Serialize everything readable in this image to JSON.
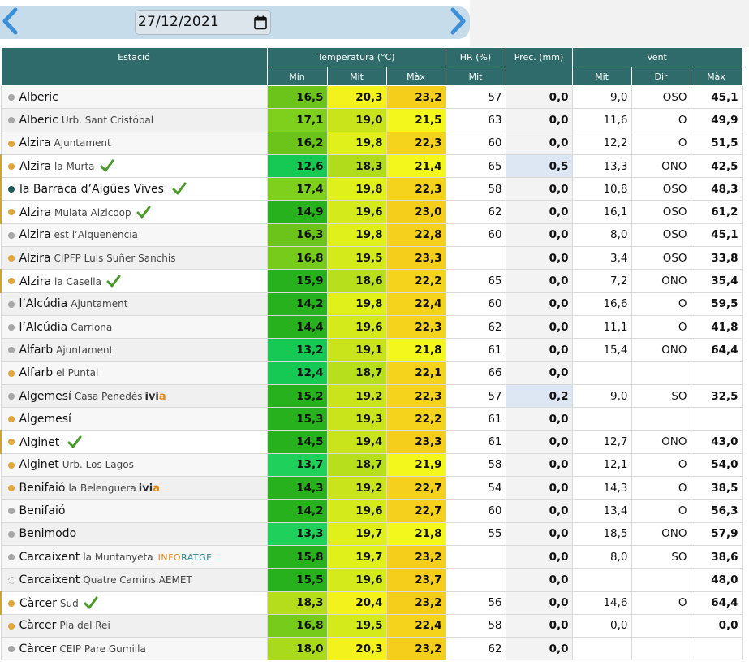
{
  "toolbar": {
    "date": "27/12/2021",
    "colors": {
      "bar": "#c7dcea",
      "arrow": "#3a8fd6"
    }
  },
  "table": {
    "headers": {
      "station": "Estació",
      "temperature": "Temperatura (°C)",
      "humidity": "HR (%)",
      "precip": "Prec. (mm)",
      "wind": "Vent",
      "min": "Mín",
      "mit": "Mit",
      "max": "Màx",
      "hr_mit": "Mit",
      "wind_mit": "Mit",
      "wind_dir": "Dir",
      "wind_max": "Màx"
    },
    "rows": [
      {
        "name": "Alberic",
        "sub": "",
        "dot": "#a7a7a7",
        "tick": false,
        "badge": "",
        "hl": false,
        "tmin": "16,5",
        "tmit": "20,3",
        "tmax": "23,2",
        "hr": "57",
        "prec": "0,0",
        "pblue": false,
        "wmit": "9,0",
        "wdir": "OSO",
        "wmax": "45,1",
        "cmin": "#6cc41a",
        "cmit": "#f3f21c",
        "cmax": "#f5ce1c"
      },
      {
        "name": "Alberic",
        "sub": "Urb. Sant Cristóbal",
        "dot": "#a7a7a7",
        "tick": false,
        "badge": "",
        "hl": false,
        "tmin": "17,1",
        "tmit": "19,0",
        "tmax": "21,5",
        "hr": "63",
        "prec": "0,0",
        "pblue": false,
        "wmit": "11,6",
        "wdir": "O",
        "wmax": "49,9",
        "cmin": "#7ed01c",
        "cmit": "#c9e41a",
        "cmax": "#f4f71c"
      },
      {
        "name": "Alzira",
        "sub": "Ajuntament",
        "dot": "#e2a53b",
        "tick": false,
        "badge": "",
        "hl": false,
        "tmin": "16,2",
        "tmit": "19,8",
        "tmax": "22,3",
        "hr": "60",
        "prec": "0,0",
        "pblue": false,
        "wmit": "12,2",
        "wdir": "O",
        "wmax": "51,5",
        "cmin": "#6cc41a",
        "cmit": "#dff01a",
        "cmax": "#f5d31c"
      },
      {
        "name": "Alzira",
        "sub": "la Murta",
        "dot": "#e2a53b",
        "tick": true,
        "badge": "",
        "hl": true,
        "tmin": "12,6",
        "tmit": "18,3",
        "tmax": "21,4",
        "hr": "65",
        "prec": "0,5",
        "pblue": true,
        "wmit": "13,3",
        "wdir": "ONO",
        "wmax": "42,5",
        "cmin": "#15c954",
        "cmit": "#b0dc1c",
        "cmax": "#f3f71c"
      },
      {
        "name": "la Barraca d’Aigües Vives",
        "sub": "",
        "dot": "#1f5a5a",
        "tick": true,
        "badge": "",
        "hl": true,
        "tmin": "17,4",
        "tmit": "19,8",
        "tmax": "22,3",
        "hr": "58",
        "prec": "0,0",
        "pblue": false,
        "wmit": "10,8",
        "wdir": "OSO",
        "wmax": "48,3",
        "cmin": "#7ed01c",
        "cmit": "#dff01a",
        "cmax": "#f5d31c"
      },
      {
        "name": "Alzira",
        "sub": "Mulata Alzicoop",
        "dot": "#e2a53b",
        "tick": true,
        "badge": "",
        "hl": true,
        "tmin": "14,9",
        "tmit": "19,6",
        "tmax": "23,0",
        "hr": "62",
        "prec": "0,0",
        "pblue": false,
        "wmit": "16,1",
        "wdir": "OSO",
        "wmax": "61,2",
        "cmin": "#27b11d",
        "cmit": "#d4ea1a",
        "cmax": "#f5ce1c"
      },
      {
        "name": "Alzira",
        "sub": "est l’Alquenència",
        "dot": "#a7a7a7",
        "tick": false,
        "badge": "",
        "hl": false,
        "tmin": "16,3",
        "tmit": "19,8",
        "tmax": "22,8",
        "hr": "60",
        "prec": "0,0",
        "pblue": false,
        "wmit": "8,0",
        "wdir": "OSO",
        "wmax": "45,1",
        "cmin": "#6cc41a",
        "cmit": "#dff01a",
        "cmax": "#f5d01c"
      },
      {
        "name": "Alzira",
        "sub": "CIPFP Luis Suñer Sanchis",
        "dot": "#e2a53b",
        "tick": false,
        "badge": "",
        "hl": false,
        "tmin": "16,8",
        "tmit": "19,5",
        "tmax": "23,3",
        "hr": "",
        "prec": "0,0",
        "pblue": false,
        "wmit": "3,4",
        "wdir": "OSO",
        "wmax": "33,8",
        "cmin": "#76cb1b",
        "cmit": "#d4ea1a",
        "cmax": "#f5ce1c"
      },
      {
        "name": "Alzira",
        "sub": "la Casella",
        "dot": "#e2a53b",
        "tick": true,
        "badge": "",
        "hl": true,
        "tmin": "15,9",
        "tmit": "18,6",
        "tmax": "22,2",
        "hr": "65",
        "prec": "0,0",
        "pblue": false,
        "wmit": "7,2",
        "wdir": "ONO",
        "wmax": "35,4",
        "cmin": "#27b11d",
        "cmit": "#b8df1c",
        "cmax": "#f5d31c"
      },
      {
        "name": "l’Alcúdia",
        "sub": "Ajuntament",
        "dot": "#a7a7a7",
        "tick": false,
        "badge": "",
        "hl": false,
        "tmin": "14,2",
        "tmit": "19,8",
        "tmax": "22,4",
        "hr": "60",
        "prec": "0,0",
        "pblue": false,
        "wmit": "16,6",
        "wdir": "O",
        "wmax": "59,5",
        "cmin": "#27b11d",
        "cmit": "#dff01a",
        "cmax": "#f5d31c"
      },
      {
        "name": "l’Alcúdia",
        "sub": "Carriona",
        "dot": "#a7a7a7",
        "tick": false,
        "badge": "",
        "hl": false,
        "tmin": "14,4",
        "tmit": "19,6",
        "tmax": "22,3",
        "hr": "62",
        "prec": "0,0",
        "pblue": false,
        "wmit": "11,1",
        "wdir": "O",
        "wmax": "41,8",
        "cmin": "#27b11d",
        "cmit": "#d4ea1a",
        "cmax": "#f5d31c"
      },
      {
        "name": "Alfarb",
        "sub": "Ajuntament",
        "dot": "#a7a7a7",
        "tick": false,
        "badge": "",
        "hl": false,
        "tmin": "13,2",
        "tmit": "19,1",
        "tmax": "21,8",
        "hr": "61",
        "prec": "0,0",
        "pblue": false,
        "wmit": "15,4",
        "wdir": "ONO",
        "wmax": "64,4",
        "cmin": "#15c954",
        "cmit": "#c9e41a",
        "cmax": "#f3f71c"
      },
      {
        "name": "Alfarb",
        "sub": "el Puntal",
        "dot": "#e2a53b",
        "tick": false,
        "badge": "",
        "hl": false,
        "tmin": "12,4",
        "tmit": "18,7",
        "tmax": "22,1",
        "hr": "66",
        "prec": "0,0",
        "pblue": false,
        "wmit": "",
        "wdir": "",
        "wmax": "",
        "cmin": "#15c954",
        "cmit": "#b8df1c",
        "cmax": "#f5d31c"
      },
      {
        "name": "Algemesí",
        "sub": "Casa Penedés",
        "dot": "#a7a7a7",
        "tick": false,
        "badge": "ivia",
        "hl": false,
        "tmin": "15,2",
        "tmit": "19,2",
        "tmax": "22,3",
        "hr": "57",
        "prec": "0,2",
        "pblue": true,
        "wmit": "9,0",
        "wdir": "SO",
        "wmax": "32,5",
        "cmin": "#27b11d",
        "cmit": "#c9e41a",
        "cmax": "#f5d31c"
      },
      {
        "name": "Algemesí",
        "sub": "",
        "dot": "#e2a53b",
        "tick": false,
        "badge": "",
        "hl": false,
        "tmin": "15,3",
        "tmit": "19,3",
        "tmax": "22,2",
        "hr": "61",
        "prec": "0,0",
        "pblue": false,
        "wmit": "",
        "wdir": "",
        "wmax": "",
        "cmin": "#27b11d",
        "cmit": "#c9e41a",
        "cmax": "#f5d31c"
      },
      {
        "name": "Alginet",
        "sub": "",
        "dot": "#e2a53b",
        "tick": true,
        "badge": "",
        "hl": true,
        "tmin": "14,5",
        "tmit": "19,4",
        "tmax": "23,3",
        "hr": "61",
        "prec": "0,0",
        "pblue": false,
        "wmit": "12,7",
        "wdir": "ONO",
        "wmax": "43,0",
        "cmin": "#27b11d",
        "cmit": "#c9e41a",
        "cmax": "#f5ce1c"
      },
      {
        "name": "Alginet",
        "sub": "Urb. Los Lagos",
        "dot": "#e2a53b",
        "tick": false,
        "badge": "",
        "hl": false,
        "tmin": "13,7",
        "tmit": "18,7",
        "tmax": "21,9",
        "hr": "58",
        "prec": "0,0",
        "pblue": false,
        "wmit": "12,1",
        "wdir": "O",
        "wmax": "54,0",
        "cmin": "#1fd05a",
        "cmit": "#b8df1c",
        "cmax": "#f3f71c"
      },
      {
        "name": "Benifaió",
        "sub": "la Belenguera",
        "dot": "#e2a53b",
        "tick": false,
        "badge": "ivia",
        "hl": false,
        "tmin": "14,3",
        "tmit": "19,2",
        "tmax": "22,7",
        "hr": "54",
        "prec": "0,0",
        "pblue": false,
        "wmit": "14,3",
        "wdir": "O",
        "wmax": "38,5",
        "cmin": "#27b11d",
        "cmit": "#c9e41a",
        "cmax": "#f5d01c"
      },
      {
        "name": "Benifaió",
        "sub": "",
        "dot": "#a7a7a7",
        "tick": false,
        "badge": "",
        "hl": false,
        "tmin": "14,2",
        "tmit": "19,6",
        "tmax": "22,7",
        "hr": "60",
        "prec": "0,0",
        "pblue": false,
        "wmit": "13,4",
        "wdir": "O",
        "wmax": "56,3",
        "cmin": "#27b11d",
        "cmit": "#d4ea1a",
        "cmax": "#f5d01c"
      },
      {
        "name": "Benimodo",
        "sub": "",
        "dot": "#a7a7a7",
        "tick": false,
        "badge": "",
        "hl": false,
        "tmin": "13,3",
        "tmit": "19,7",
        "tmax": "21,8",
        "hr": "55",
        "prec": "0,0",
        "pblue": false,
        "wmit": "18,5",
        "wdir": "ONO",
        "wmax": "57,9",
        "cmin": "#1fd05a",
        "cmit": "#dff01a",
        "cmax": "#f3f71c"
      },
      {
        "name": "Carcaixent",
        "sub": "la Muntanyeta",
        "dot": "#a7a7a7",
        "tick": false,
        "badge": "infor",
        "hl": false,
        "tmin": "15,8",
        "tmit": "19,7",
        "tmax": "23,2",
        "hr": "",
        "prec": "0,0",
        "pblue": false,
        "wmit": "8,0",
        "wdir": "SO",
        "wmax": "38,6",
        "cmin": "#27b11d",
        "cmit": "#dff01a",
        "cmax": "#f5ce1c"
      },
      {
        "name": "Carcaixent",
        "sub": "Quatre Camins AEMET",
        "dot": "",
        "tick": false,
        "badge": "",
        "hl": false,
        "tmin": "15,5",
        "tmit": "19,6",
        "tmax": "23,7",
        "hr": "",
        "prec": "0,0",
        "pblue": false,
        "wmit": "",
        "wdir": "",
        "wmax": "48,0",
        "cmin": "#27b11d",
        "cmit": "#d4ea1a",
        "cmax": "#f5ce1c"
      },
      {
        "name": "Càrcer",
        "sub": "Sud",
        "dot": "#e2a53b",
        "tick": true,
        "badge": "",
        "hl": true,
        "tmin": "18,3",
        "tmit": "20,4",
        "tmax": "23,2",
        "hr": "56",
        "prec": "0,0",
        "pblue": false,
        "wmit": "14,6",
        "wdir": "O",
        "wmax": "64,4",
        "cmin": "#b5dd1c",
        "cmit": "#f3f21c",
        "cmax": "#f5ce1c"
      },
      {
        "name": "Càrcer",
        "sub": "Pla del Rei",
        "dot": "#e2a53b",
        "tick": false,
        "badge": "",
        "hl": false,
        "tmin": "16,8",
        "tmit": "19,5",
        "tmax": "22,4",
        "hr": "58",
        "prec": "0,0",
        "pblue": false,
        "wmit": "0,0",
        "wdir": "",
        "wmax": "0,0",
        "cmin": "#76cb1b",
        "cmit": "#d4ea1a",
        "cmax": "#f5d31c"
      },
      {
        "name": "Càrcer",
        "sub": "CEIP Pare Gumilla",
        "dot": "#a7a7a7",
        "tick": false,
        "badge": "",
        "hl": false,
        "tmin": "18,0",
        "tmit": "20,3",
        "tmax": "23,2",
        "hr": "62",
        "prec": "0,0",
        "pblue": false,
        "wmit": "",
        "wdir": "",
        "wmax": "",
        "cmin": "#a9da1c",
        "cmit": "#f3f21c",
        "cmax": "#f5ce1c"
      }
    ],
    "badges": {
      "ivia_iv": "ivi",
      "ivia_a": "a",
      "infor_1": "INFO",
      "infor_2": "RATGE"
    }
  }
}
